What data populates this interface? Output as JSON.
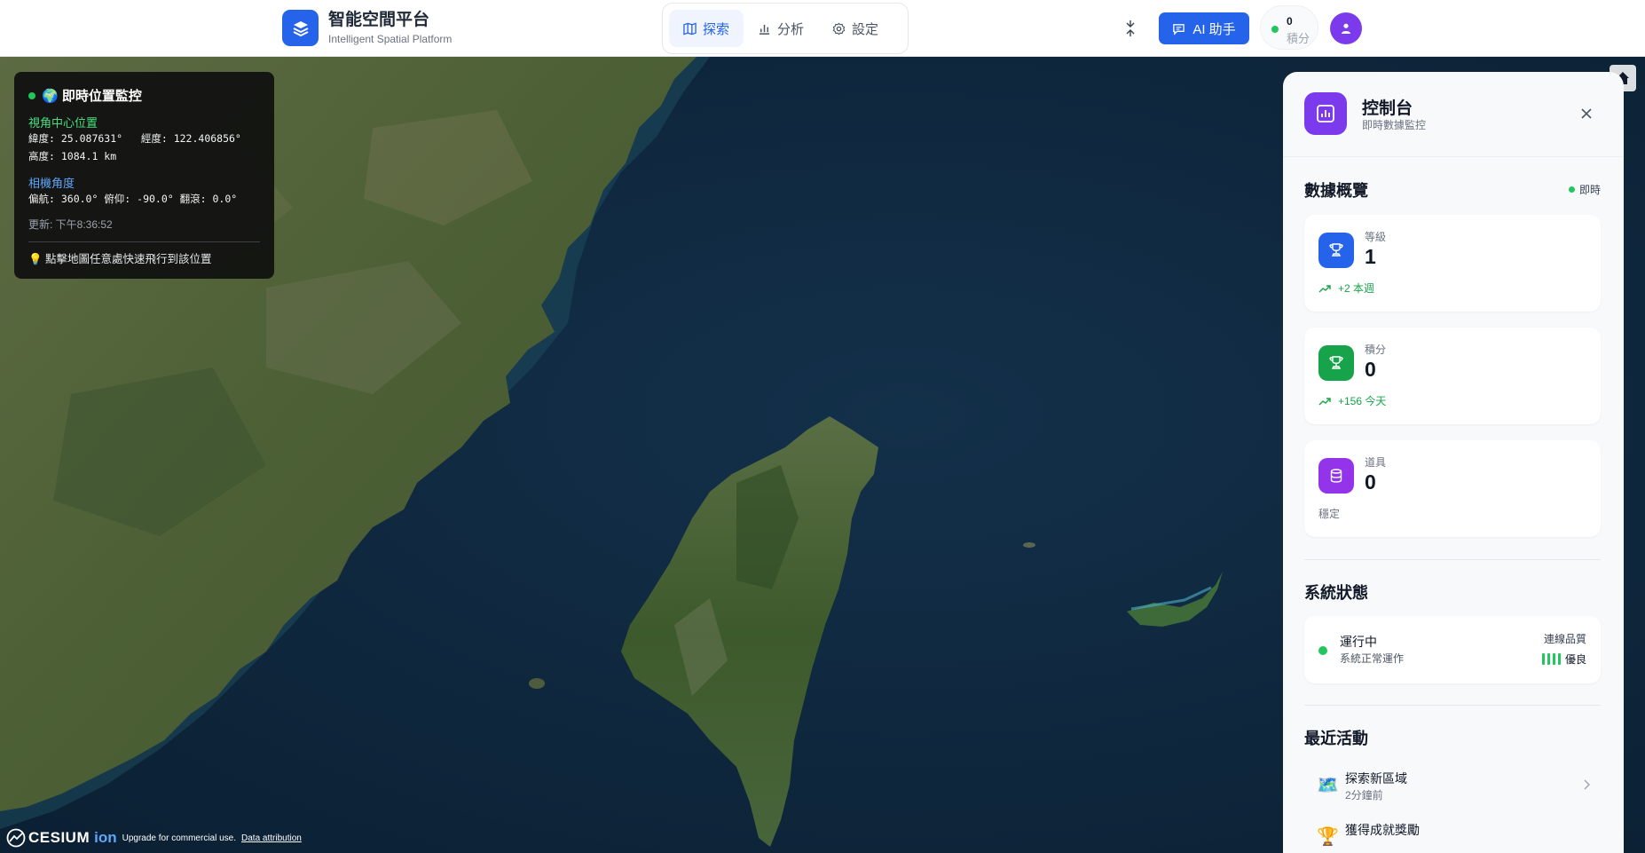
{
  "header": {
    "title": "智能空間平台",
    "subtitle": "Intelligent Spatial Platform",
    "nav": [
      {
        "label": "探索",
        "icon": "map-icon",
        "active": true
      },
      {
        "label": "分析",
        "icon": "bar-chart-icon",
        "active": false
      },
      {
        "label": "設定",
        "icon": "gear-icon",
        "active": false
      }
    ],
    "ai_label": "AI 助手",
    "score_value": "0",
    "score_label": "積分"
  },
  "monitor": {
    "title": "🌍 即時位置監控",
    "center_label": "視角中心位置",
    "lat_lon": "緯度: 25.087631°   經度: 122.406856°",
    "height": "高度: 1084.1 km",
    "camera_label": "相機角度",
    "angles": "偏航: 360.0° 俯仰: -90.0° 翻滾: 0.0°",
    "updated": "更新: 下午8:36:52",
    "tip": "💡 點擊地圖任意處快速飛行到該位置"
  },
  "cesium": {
    "word": "CESIUM",
    "ion": "ion",
    "note": "Upgrade for commercial use.",
    "link": "Data attribution"
  },
  "panel": {
    "title": "控制台",
    "subtitle": "即時數據監控",
    "overview_title": "數據概覽",
    "live_label": "即時",
    "stats": [
      {
        "label": "等級",
        "value": "1",
        "trend": "+2 本週",
        "color": "#2563eb",
        "icon": "trophy-icon"
      },
      {
        "label": "積分",
        "value": "0",
        "trend": "+156 今天",
        "color": "#16a34a",
        "icon": "trophy-icon"
      },
      {
        "label": "道具",
        "value": "0",
        "trend": "穩定",
        "color": "#9333ea",
        "icon": "database-icon"
      }
    ],
    "system_title": "系統狀態",
    "status_main": "運行中",
    "status_sub": "系統正常運作",
    "conn_label": "連線品質",
    "conn_value": "優良",
    "conn_level_bars": 4,
    "activity_title": "最近活動",
    "activities": [
      {
        "icon": "🗺️",
        "title": "探索新區域",
        "time": "2分鐘前"
      },
      {
        "icon": "🏆",
        "title": "獲得成就獎勵",
        "time": ""
      }
    ]
  },
  "colors": {
    "primary": "#2563eb",
    "accent_purple": "#7c3aed",
    "success": "#22c55e"
  }
}
